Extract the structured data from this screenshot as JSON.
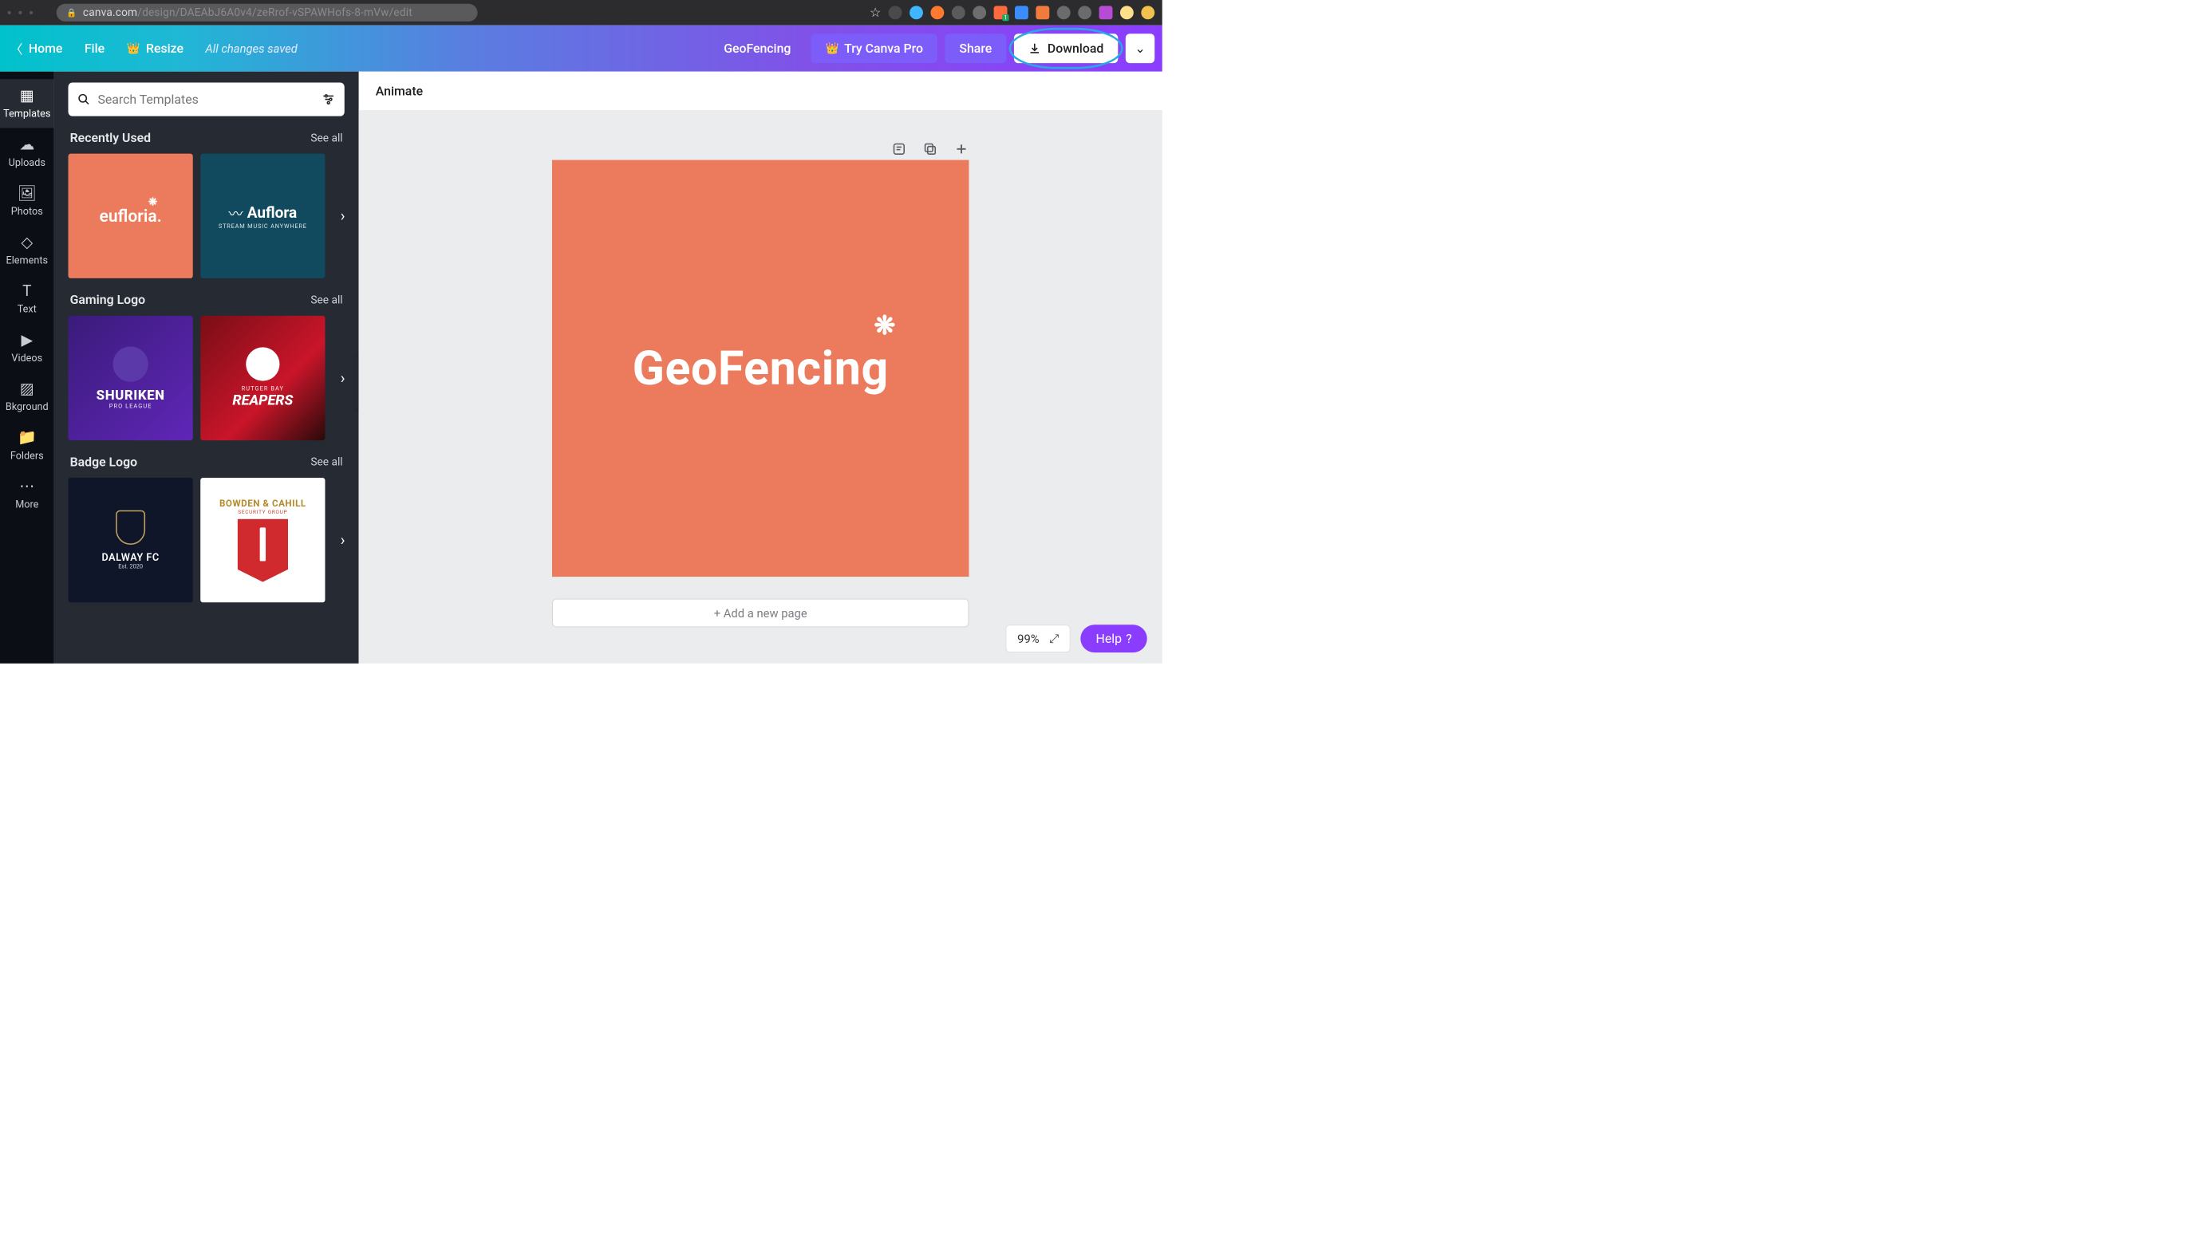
{
  "browser": {
    "url_host": "canva.com",
    "url_path": "/design/DAEAbJ6A0v4/zeRrof-vSPAWHofs-8-mVw/edit",
    "ext_badge": "1"
  },
  "topbar": {
    "home": "Home",
    "file": "File",
    "resize": "Resize",
    "saved": "All changes saved",
    "doc_title": "GeoFencing",
    "try_pro": "Try Canva Pro",
    "share": "Share",
    "download": "Download"
  },
  "rail": {
    "templates": "Templates",
    "uploads": "Uploads",
    "photos": "Photos",
    "elements": "Elements",
    "text": "Text",
    "videos": "Videos",
    "bkground": "Bkground",
    "folders": "Folders",
    "more": "More"
  },
  "panel": {
    "search_placeholder": "Search Templates",
    "see_all": "See all",
    "sections": {
      "recent": {
        "title": "Recently Used",
        "items": [
          {
            "name": "eufloria",
            "title": "eufloria."
          },
          {
            "name": "auflora",
            "title": "Auflora",
            "sub": "STREAM MUSIC ANYWHERE"
          }
        ]
      },
      "gaming": {
        "title": "Gaming Logo",
        "items": [
          {
            "name": "shuriken",
            "title": "SHURIKEN",
            "sub": "PRO LEAGUE"
          },
          {
            "name": "reapers",
            "title": "REAPERS",
            "sub": "RUTGER BAY"
          }
        ]
      },
      "badge": {
        "title": "Badge Logo",
        "items": [
          {
            "name": "dalway",
            "title": "DALWAY FC",
            "sub": "Est. 2020"
          },
          {
            "name": "bowden",
            "title": "BOWDEN & CAHILL",
            "sub": "SECURITY GROUP"
          }
        ]
      }
    }
  },
  "canvas": {
    "animate": "Animate",
    "artboard_text": "GeoFencing",
    "add_page": "+ Add a new page",
    "zoom": "99%",
    "help": "Help"
  }
}
